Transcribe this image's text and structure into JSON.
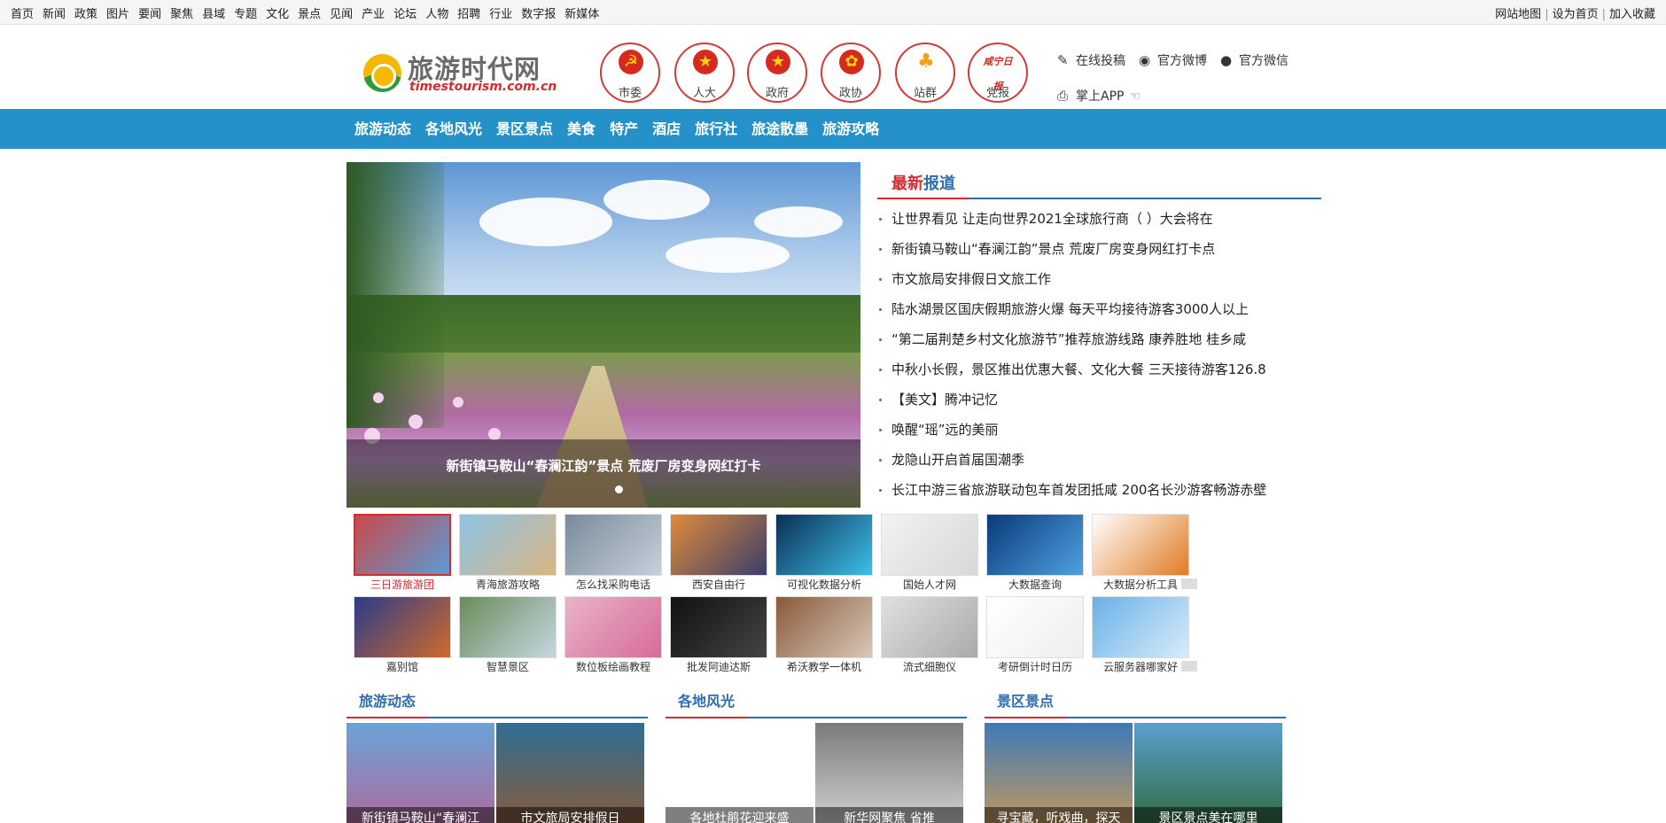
{
  "topbar": {
    "left_links": [
      "首页",
      "新闻",
      "政策",
      "图片",
      "要闻",
      "聚焦",
      "县域",
      "专题",
      "文化",
      "景点",
      "见闻",
      "产业",
      "论坛",
      "人物",
      "招聘",
      "行业",
      "数字报",
      "新媒体"
    ],
    "right_links": [
      "网站地图",
      "设为首页",
      "加入收藏"
    ]
  },
  "logo": {
    "cn": "旅游时代网",
    "en": "timestourism.com.cn"
  },
  "orgs": [
    {
      "label": "市委",
      "glyph": "☭"
    },
    {
      "label": "人大",
      "glyph": "★"
    },
    {
      "label": "政府",
      "glyph": "★"
    },
    {
      "label": "政协",
      "glyph": "✿"
    },
    {
      "label": "站群",
      "glyph": "♣"
    },
    {
      "label": "党报",
      "glyph": "咸宁日报"
    }
  ],
  "header_links": {
    "submit": "在线投稿",
    "weibo": "官方微博",
    "wechat": "官方微信",
    "app": "掌上APP"
  },
  "nav": [
    "旅游动态",
    "各地风光",
    "景区景点",
    "美食",
    "特产",
    "酒店",
    "旅行社",
    "旅途散墨",
    "旅游攻略"
  ],
  "slider": {
    "caption": "新街镇马鞍山“春澜江韵”景点 荒废厂房变身网红打卡"
  },
  "latest": {
    "title_red": "最新",
    "title_blue": "报道",
    "items": [
      "让世界看见 让走向世界2021全球旅行商（ ）大会将在",
      "新街镇马鞍山“春澜江韵”景点 荒废厂房变身网红打卡点",
      "市文旅局安排假日文旅工作",
      "陆水湖景区国庆假期旅游火爆 每天平均接待游客3000人以上",
      "“第二届荆楚乡村文化旅游节”推荐旅游线路 康养胜地 桂乡咸",
      "中秋小长假，景区推出优惠大餐、文化大餐 三天接待游客126.8",
      "【美文】腾冲记忆",
      "唤醒“瑶”远的美丽",
      "龙隐山开启首届国潮季",
      "长江中游三省旅游联动包车首发团抵咸 200名长沙游客畅游赤壁"
    ]
  },
  "thumbs_row1": [
    "三日游旅游团",
    "青海旅游攻略",
    "怎么找采购电话",
    "西安自由行",
    "可视化数据分析",
    "国始人才网",
    "大数据查询",
    "大数据分析工具"
  ],
  "thumbs_row2": [
    "嘉别馆",
    "智慧景区",
    "数位板绘画教程",
    "批发阿迪达斯",
    "希沃教学一体机",
    "流式细胞仪",
    "考研倒计时日历",
    "云服务器哪家好"
  ],
  "sections": [
    {
      "title": "旅游动态",
      "pics": [
        "新街镇马鞍山“春澜江",
        "市文旅局安排假日"
      ]
    },
    {
      "title": "各地风光",
      "pics": [
        "各地杜鹃花迎来盛",
        "新华网聚焦 省推"
      ]
    },
    {
      "title": "景区景点",
      "pics": [
        "寻宝藏，听戏曲，探天",
        "景区景点美在哪里"
      ]
    }
  ]
}
